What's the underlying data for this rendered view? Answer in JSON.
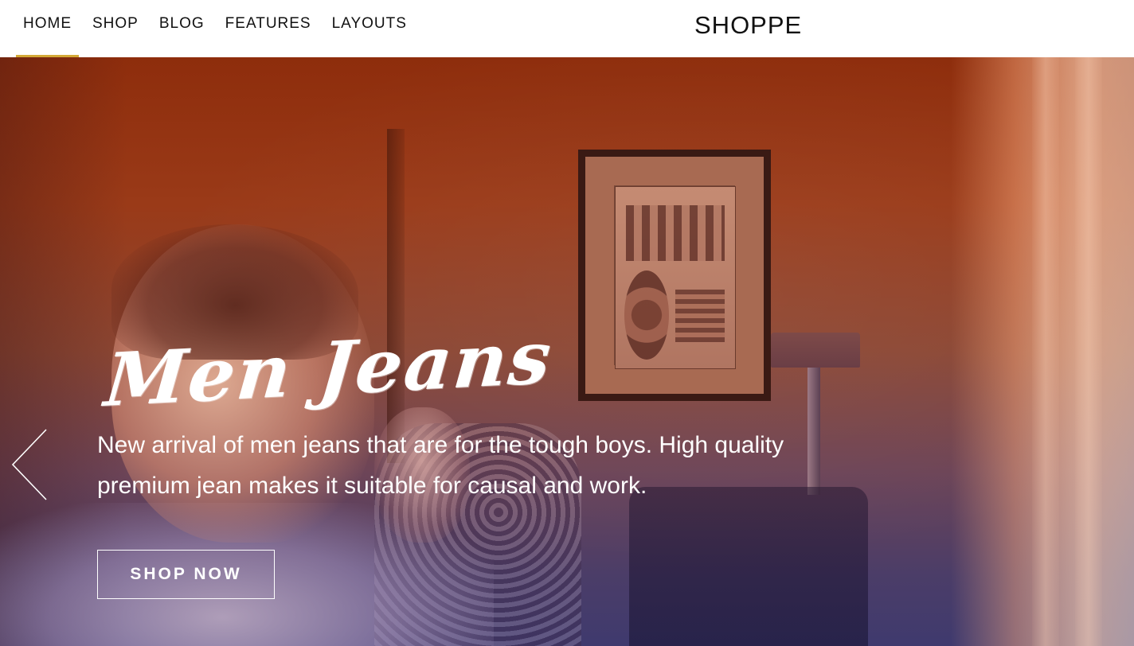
{
  "header": {
    "nav": [
      {
        "label": "HOME",
        "active": true
      },
      {
        "label": "SHOP",
        "active": false
      },
      {
        "label": "BLOG",
        "active": false
      },
      {
        "label": "FEATURES",
        "active": false
      },
      {
        "label": "LAYOUTS",
        "active": false
      }
    ],
    "logo": "SHOPPE",
    "active_indicator_color": "#d4a936"
  },
  "hero": {
    "title": "Men Jeans",
    "description": "New arrival of men jeans that are for the tough boys. High quality premium jean makes it suitable for causal and work.",
    "cta_label": "SHOP NOW",
    "prev_icon": "chevron-left-icon",
    "overlay_colors": {
      "top": "#8e2d0c",
      "bottom": "#3f3a6e"
    }
  }
}
